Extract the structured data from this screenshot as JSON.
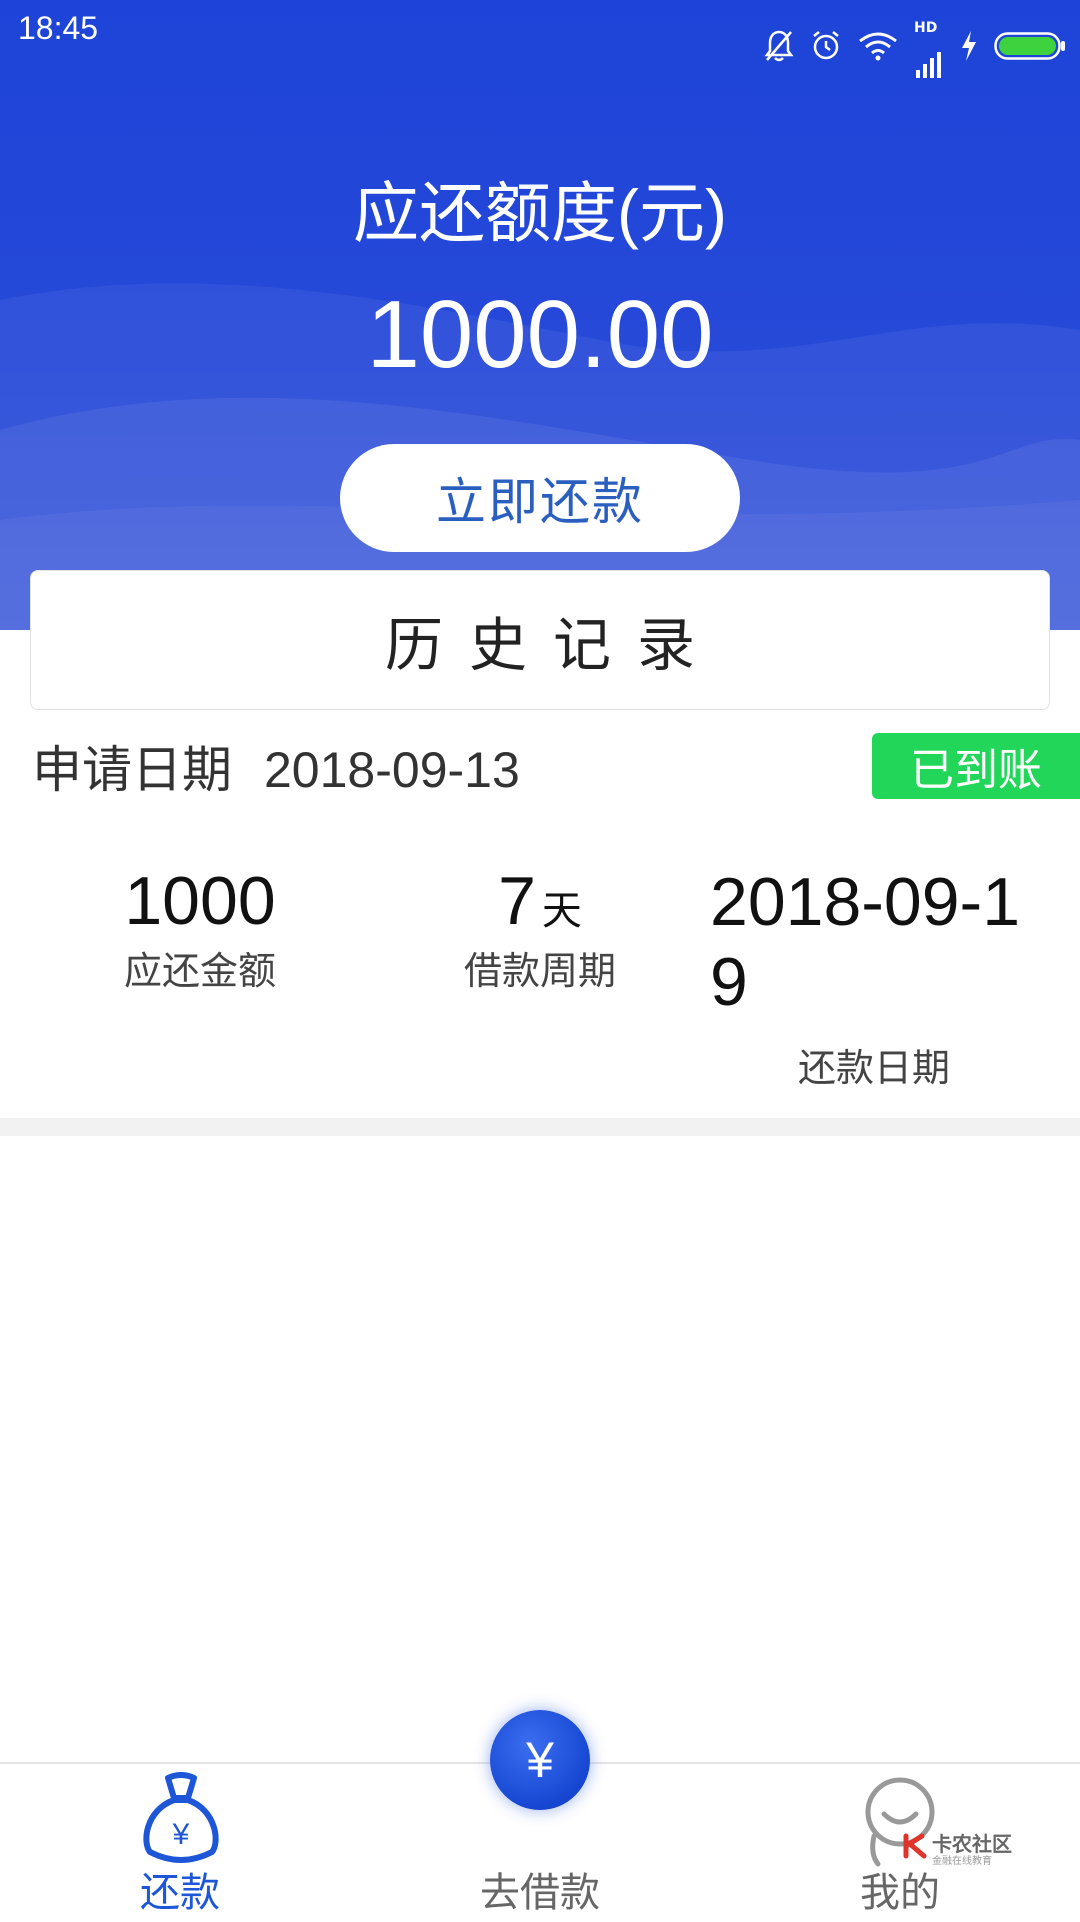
{
  "status_bar": {
    "time": "18:45",
    "network_label": "HD",
    "icons": [
      "bell-off-icon",
      "alarm-icon",
      "wifi-icon",
      "signal-icon",
      "charging-icon",
      "battery-icon"
    ]
  },
  "summary": {
    "title": "应还额度(元)",
    "amount": "1000.00",
    "repay_button": "立即还款"
  },
  "history": {
    "title": "历史记录"
  },
  "record": {
    "apply_label": "申请日期",
    "apply_date": "2018-09-13",
    "status": "已到账",
    "amount": "1000",
    "amount_label": "应还金额",
    "period": "7",
    "period_unit": "天",
    "period_label": "借款周期",
    "due_date": "2018-09-19",
    "due_label": "还款日期"
  },
  "tabs": {
    "repay": "还款",
    "borrow": "去借款",
    "mine": "我的",
    "borrow_fab_symbol": "¥"
  },
  "watermark": {
    "text": "卡农社区",
    "sub": "金融在线教育"
  },
  "colors": {
    "header_blue": "#2447d8",
    "accent_blue": "#1e56d8",
    "status_green": "#22d65a"
  }
}
